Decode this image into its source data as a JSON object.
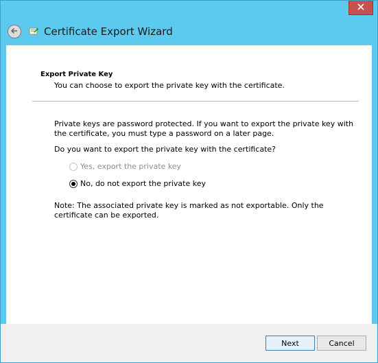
{
  "window": {
    "title": "Certificate Export Wizard",
    "close_icon": "close-icon",
    "back_icon": "back-arrow-icon",
    "app_icon": "certificate-icon"
  },
  "section": {
    "heading": "Export Private Key",
    "description": "You can choose to export the private key with the certificate."
  },
  "body": {
    "intro": "Private keys are password protected. If you want to export the private key with the certificate, you must type a password on a later page.",
    "question": "Do you want to export the private key with the certificate?",
    "options": [
      {
        "label": "Yes, export the private key",
        "selected": false,
        "enabled": false
      },
      {
        "label": "No, do not export the private key",
        "selected": true,
        "enabled": true
      }
    ],
    "note": "Note: The associated private key is marked as not exportable. Only the certificate can be exported."
  },
  "footer": {
    "next_label": "Next",
    "cancel_label": "Cancel"
  },
  "colors": {
    "chrome": "#5ccaee",
    "close": "#c75050",
    "primary_border": "#3c7fb1"
  }
}
